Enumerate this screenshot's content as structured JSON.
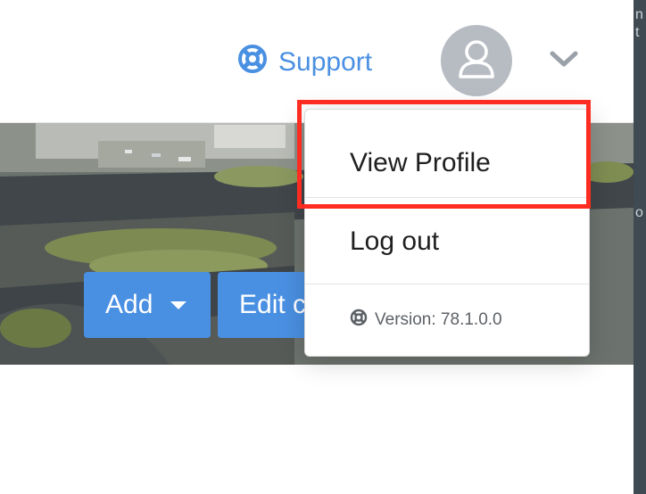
{
  "header": {
    "support_label": "Support",
    "support_icon": "lifebuoy-icon",
    "avatar_icon": "user-icon",
    "menu_toggle_icon": "chevron-down-icon"
  },
  "banner": {
    "add_label": "Add",
    "edit_label": "Edit c"
  },
  "user_menu": {
    "items": [
      {
        "label": "View Profile"
      },
      {
        "label": "Log out"
      }
    ],
    "version_label": "Version: 78.1.0.0",
    "version_icon": "lifebuoy-icon"
  },
  "colors": {
    "accent": "#4a90e2",
    "avatar_bg": "#b7bcc3",
    "highlight": "#ff2d21"
  }
}
